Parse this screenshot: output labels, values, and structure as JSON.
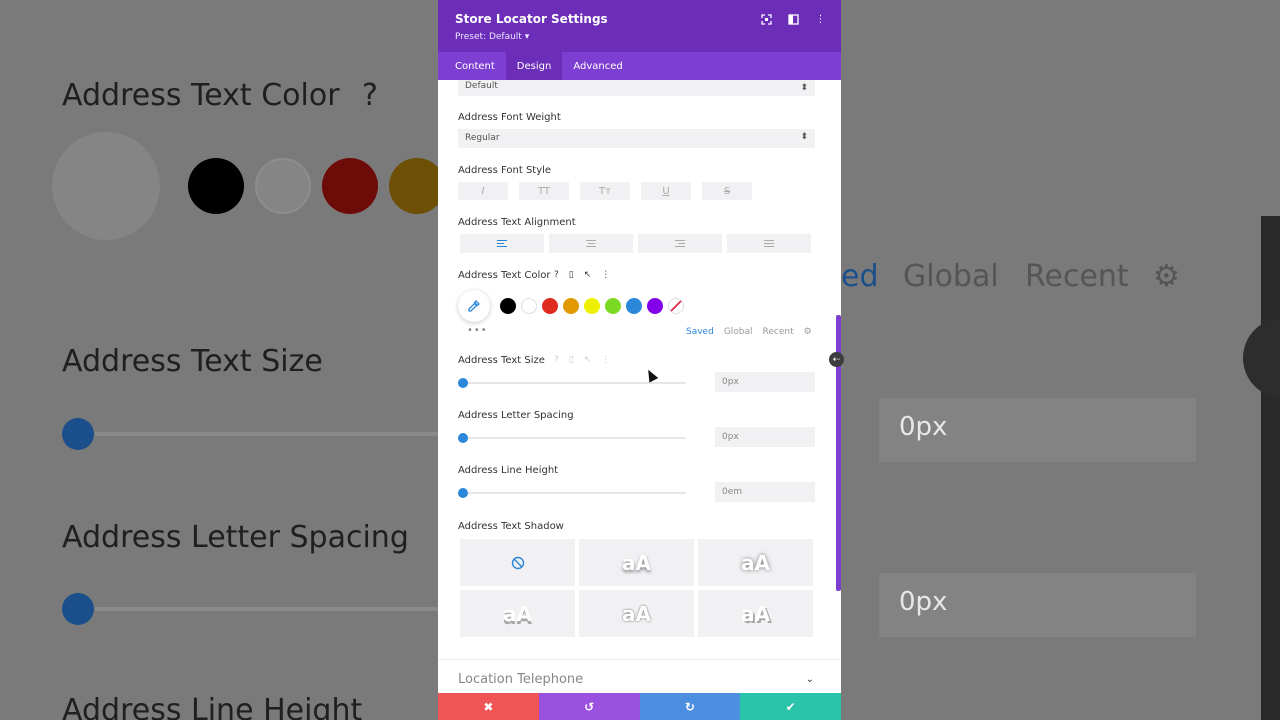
{
  "background": {
    "left_title": "Address Text Color",
    "left_q": "?",
    "left_size_title": "Address Text Size",
    "left_spacing_title": "Address Letter Spacing",
    "left_line_title": "Address Line Height",
    "right_tabs": [
      "ed",
      "Global",
      "Recent"
    ],
    "right_input_1": "0px",
    "right_input_2": "0px"
  },
  "panel": {
    "title": "Store Locator Settings",
    "preset": "Preset: Default ▾",
    "tabs": [
      "Content",
      "Design",
      "Advanced"
    ],
    "active_tab": "Design"
  },
  "fields": {
    "top_select_value": "Default",
    "font_weight_label": "Address Font Weight",
    "font_weight_value": "Regular",
    "font_style_label": "Address Font Style",
    "font_style_buttons": [
      "I",
      "TT",
      "Tт",
      "U",
      "S"
    ],
    "text_align_label": "Address Text Alignment",
    "text_color_label": "Address Text Color",
    "palette_tabs": [
      "Saved",
      "Global",
      "Recent"
    ],
    "text_size_label": "Address Text Size",
    "text_size_value": "0px",
    "letter_spacing_label": "Address Letter Spacing",
    "letter_spacing_value": "0px",
    "line_height_label": "Address Line Height",
    "line_height_value": "0em",
    "text_shadow_label": "Address Text Shadow",
    "shadow_sample": "aA",
    "next_section": "Location Telephone"
  },
  "colors": {
    "swatches": [
      "#000000",
      "#ffffff",
      "#e02b20",
      "#e09900",
      "#edf000",
      "#7cda24",
      "#2b87da",
      "#8300e9"
    ],
    "accent": "#2b87da",
    "header": "#6c2eb9",
    "tabs": "#7d3fd1",
    "footer": [
      "#ef5555",
      "#9b51e0",
      "#4c8ee0",
      "#29c4a9"
    ]
  },
  "footer": {
    "cancel_icon": "✖",
    "undo_icon": "↺",
    "redo_icon": "↻",
    "save_icon": "✔"
  }
}
